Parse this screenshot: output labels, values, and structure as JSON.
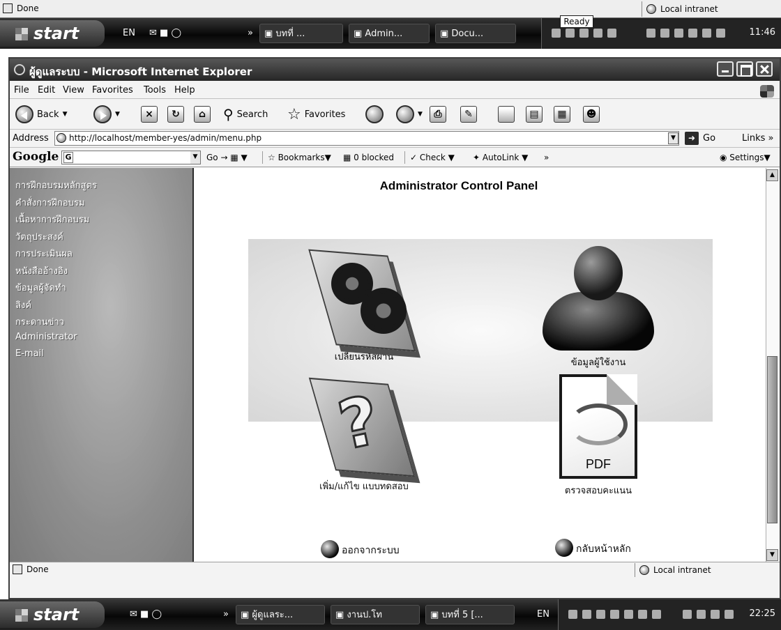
{
  "outer_status": {
    "text": "Done",
    "zone": "Local intranet",
    "tooltip": "Ready"
  },
  "taskbar_top": {
    "start": "start",
    "lang": "EN",
    "items": [
      "บทที่ ...",
      "Admin...",
      "Docu..."
    ],
    "clock": "11:46"
  },
  "window": {
    "title": "ผู้ดูแลระบบ - Microsoft Internet Explorer"
  },
  "menu": [
    "File",
    "Edit",
    "View",
    "Favorites",
    "Tools",
    "Help"
  ],
  "toolbar": {
    "back": "Back",
    "search": "Search",
    "favorites": "Favorites"
  },
  "address": {
    "label": "Address",
    "url": "http://localhost/member-yes/admin/menu.php",
    "go": "Go",
    "links": "Links"
  },
  "google": {
    "logo": "Google",
    "go": "Go",
    "bookmarks": "Bookmarks",
    "blocked": "0 blocked",
    "check": "Check",
    "autolink": "AutoLink",
    "settings": "Settings"
  },
  "sidebar": {
    "items": [
      "การฝึกอบรมหลักสูตร",
      "คำสั่งการฝึกอบรม",
      "เนื้อหาการฝึกอบรม",
      "วัตถุประสงค์",
      "การประเมินผล",
      "หนังสืออ้างอิง",
      "ข้อมูลผู้จัดทำ",
      "ลิงค์",
      "กระดานข่าว",
      "Administrator",
      "E-mail"
    ]
  },
  "panel": {
    "title": "Administrator Control Panel",
    "tiles": {
      "change_password": "เปลี่ยนรหัสผ่าน",
      "user_info": "ข้อมูลผู้ใช้งาน",
      "edit_quiz": "เพิ่ม/แก้ไข แบบทดสอบ",
      "check_score": "ตรวจสอบคะแนน",
      "pdf_label": "PDF"
    },
    "links": {
      "logout": "ออกจากระบบ",
      "home": "กลับหน้าหลัก"
    }
  },
  "ie_status": {
    "text": "Done",
    "zone": "Local intranet"
  },
  "taskbar_bottom": {
    "start": "start",
    "items": [
      "ผู้ดูแลระ...",
      "งานป.โท",
      "บทที่ 5 [..."
    ],
    "lang": "EN",
    "clock": "22:25"
  }
}
